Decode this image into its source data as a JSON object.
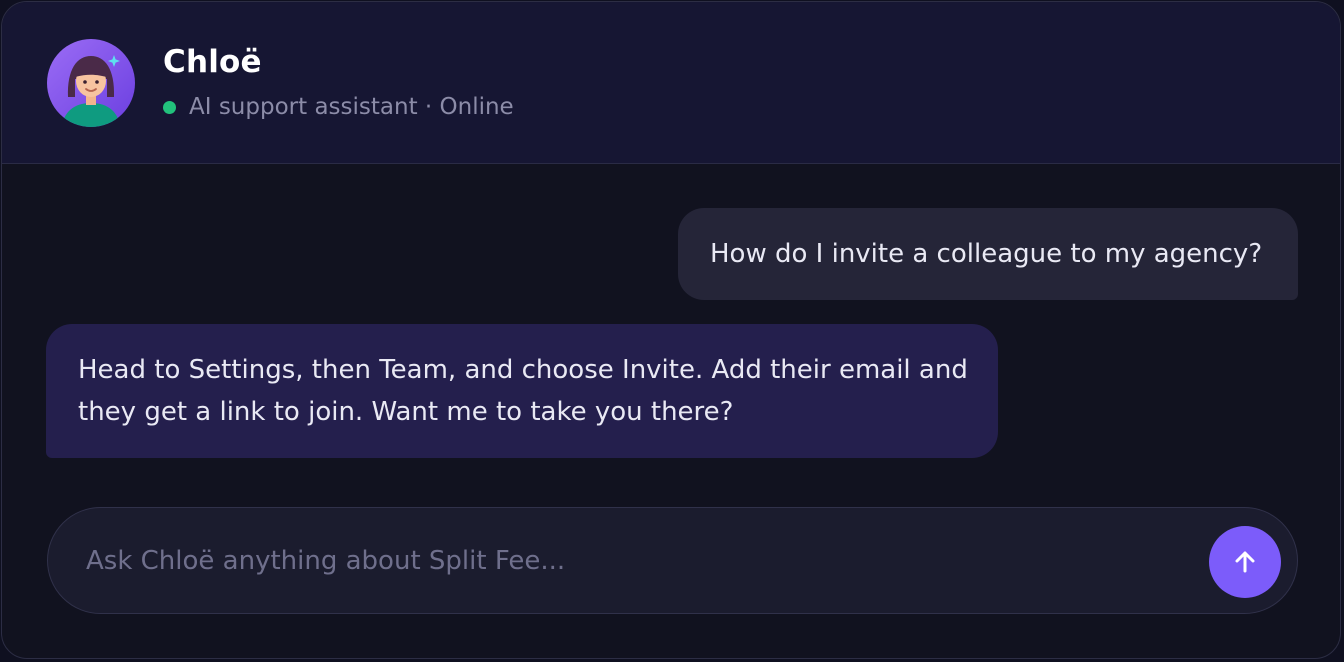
{
  "assistant": {
    "name": "Chloë",
    "status_text": "AI support assistant · Online",
    "status_color": "#22c17c",
    "avatar_icon": "assistant-avatar-icon"
  },
  "messages": [
    {
      "sender": "user",
      "text": "How do I invite a colleague to my agency?"
    },
    {
      "sender": "assistant",
      "text": "Head to Settings, then Team, and choose Invite. Add their email and they get a link to join. Want me to take you there?"
    }
  ],
  "composer": {
    "placeholder": "Ask Chloë anything about Split Fee...",
    "value": "",
    "send_icon": "arrow-up-icon"
  },
  "colors": {
    "accent": "#7c5cfa",
    "header_bg": "#161633",
    "assistant_bubble": "#241f4d",
    "user_bubble": "#252538"
  }
}
